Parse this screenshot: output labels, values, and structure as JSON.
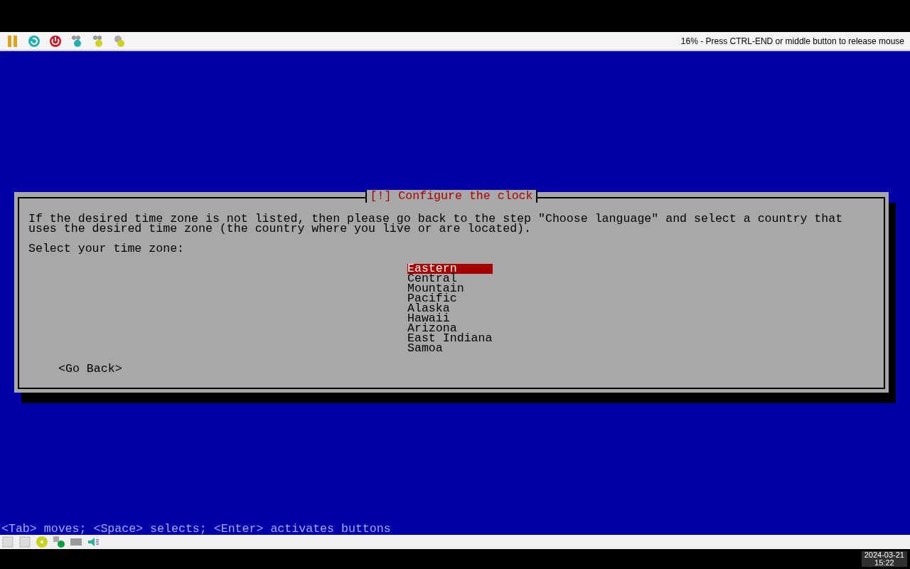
{
  "toolbar": {
    "status_text": "16% - Press CTRL-END or middle button to release mouse"
  },
  "dialog": {
    "title": "[!] Configure the clock",
    "description": "If the desired time zone is not listed, then please go back to the step \"Choose language\" and select a country that uses the desired time zone (the country where you live or are located).",
    "prompt": "Select your time zone:",
    "options": [
      {
        "label": "Eastern",
        "selected": true
      },
      {
        "label": "Central",
        "selected": false
      },
      {
        "label": "Mountain",
        "selected": false
      },
      {
        "label": "Pacific",
        "selected": false
      },
      {
        "label": "Alaska",
        "selected": false
      },
      {
        "label": "Hawaii",
        "selected": false
      },
      {
        "label": "Arizona",
        "selected": false
      },
      {
        "label": "East Indiana",
        "selected": false
      },
      {
        "label": "Samoa",
        "selected": false
      }
    ],
    "back_button": "<Go Back>"
  },
  "help_line": "<Tab> moves; <Space> selects; <Enter> activates buttons",
  "clock": {
    "date": "2024-03-21",
    "time": "15:22"
  }
}
